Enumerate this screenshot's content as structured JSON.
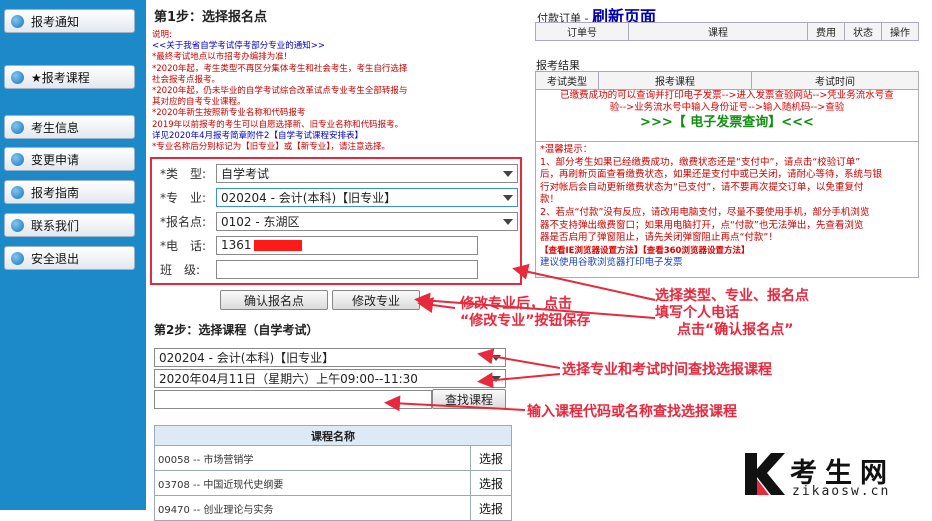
{
  "sidebar": {
    "items": [
      {
        "label": "报考通知"
      },
      {
        "label": "★报考课程"
      },
      {
        "label": "考生信息"
      },
      {
        "label": "变更申请"
      },
      {
        "label": "报考指南"
      },
      {
        "label": "联系我们"
      },
      {
        "label": "安全退出"
      }
    ]
  },
  "step1": {
    "title": "第1步：选择报名点",
    "notice_title": "说明:",
    "notice_lines": [
      "<<关于我省自学考试停考部分专业的通知>>",
      "*最终考试地点以市招考办编排为准!",
      "*2020年起，考生类型不再区分集体考生和社会考生，考生自行选择",
      "社会报考点报考。",
      "*2020年起，仍未毕业的自学考试综合改革试点专业考生全部转报与",
      "其对应的自考专业课程。",
      "*2020年新生按照新专业名称和代码报考",
      "  2019年以前报考的考生可以自愿选择新、旧专业名称和代码报考。",
      "  详见2020年4月报考简章附件2【自学考试课程安排表】",
      "*专业名称后分别标记为【旧专业】或【新专业】，请注意选择。"
    ],
    "form": {
      "type_label": "*类　型:",
      "type_value": "自学考试",
      "major_label": "*专　业:",
      "major_value": "020204 - 会计(本科)【旧专业】",
      "site_label": "*报名点:",
      "site_value": "0102 - 东湖区",
      "phone_label": "*电　话:",
      "phone_value": "1361",
      "class_label": "班　级:",
      "class_value": ""
    },
    "confirm_button": "确认报名点",
    "modify_button": "修改专业"
  },
  "step2": {
    "title": "第2步：选择课程（自学考试）",
    "major_select": "020204 - 会计(本科)【旧专业】",
    "exam_time_select": "2020年04月11日（星期六）上午09:00--11:30",
    "search_input": "",
    "search_button": "查找课程",
    "table_header": "课程名称",
    "courses": [
      {
        "name": "00058 -- 市场营销学",
        "action": "选报"
      },
      {
        "name": "03708 -- 中国近现代史纲要",
        "action": "选报"
      },
      {
        "name": "09470 -- 创业理论与实务",
        "action": "选报"
      }
    ]
  },
  "right": {
    "pay_order_label": "付款订单 -",
    "refresh": "刷新页面",
    "order_headers": [
      "订单号",
      "课程",
      "费用",
      "状态",
      "操作"
    ],
    "results_label": "报考结果",
    "result_headers": [
      "考试类型",
      "报考课程",
      "考试时间"
    ],
    "invoice_lines": [
      "已缴费成功的可以查询并打印电子发票-->进入发票查验网站-->凭业务流水号查",
      "验-->业务流水号中输入身份证号-->输入随机码-->查验"
    ],
    "invoice_link": ">>>【 电子发票查询】<<<",
    "tips_title": "*温馨提示：",
    "tips_lines": [
      "1、部分考生如果已经缴费成功，缴费状态还是“支付中”，请点击“校验订单”",
      "后，再刷新页面查看缴费状态，如果还是支付中或已关闭，请耐心等待，系统与银",
      "行对帐后会自动更新缴费状态为“已支付”，请不要再次提交订单，以免重复付",
      "款！",
      "2、若点“付款”没有反应，请改用电脑支付，尽量不要使用手机，部分手机浏览",
      "器不支持弹出缴费窗口；如果用电脑打开，点“付款”也无法弹出，先查看浏览",
      "器是否启用了弹窗阻止，请先关闭弹窗阻止再点“付款”！"
    ],
    "tips_links": "【查看IE浏览器设置方法】【查看360浏览器设置方法】",
    "tips_chrome": "建议使用谷歌浏览器打印电子发票"
  },
  "annotations": {
    "modify_note_1": "修改专业后，点击",
    "modify_note_2": "“修改专业”按钮保存",
    "select_note_1": "选择类型、专业、报名点",
    "select_note_2": "填写个人电话",
    "select_note_3": "点击“确认报名点”",
    "course_note": "选择专业和考试时间查找选报课程",
    "search_note": "输入课程代码或名称查找选报课程"
  },
  "logo": {
    "text": "考生网",
    "url": "zikaosw.cn"
  },
  "colors": {
    "sidebar_bg": "#1c89c9",
    "annotation_red": "#e8283c",
    "invoice_green": "#109010"
  }
}
